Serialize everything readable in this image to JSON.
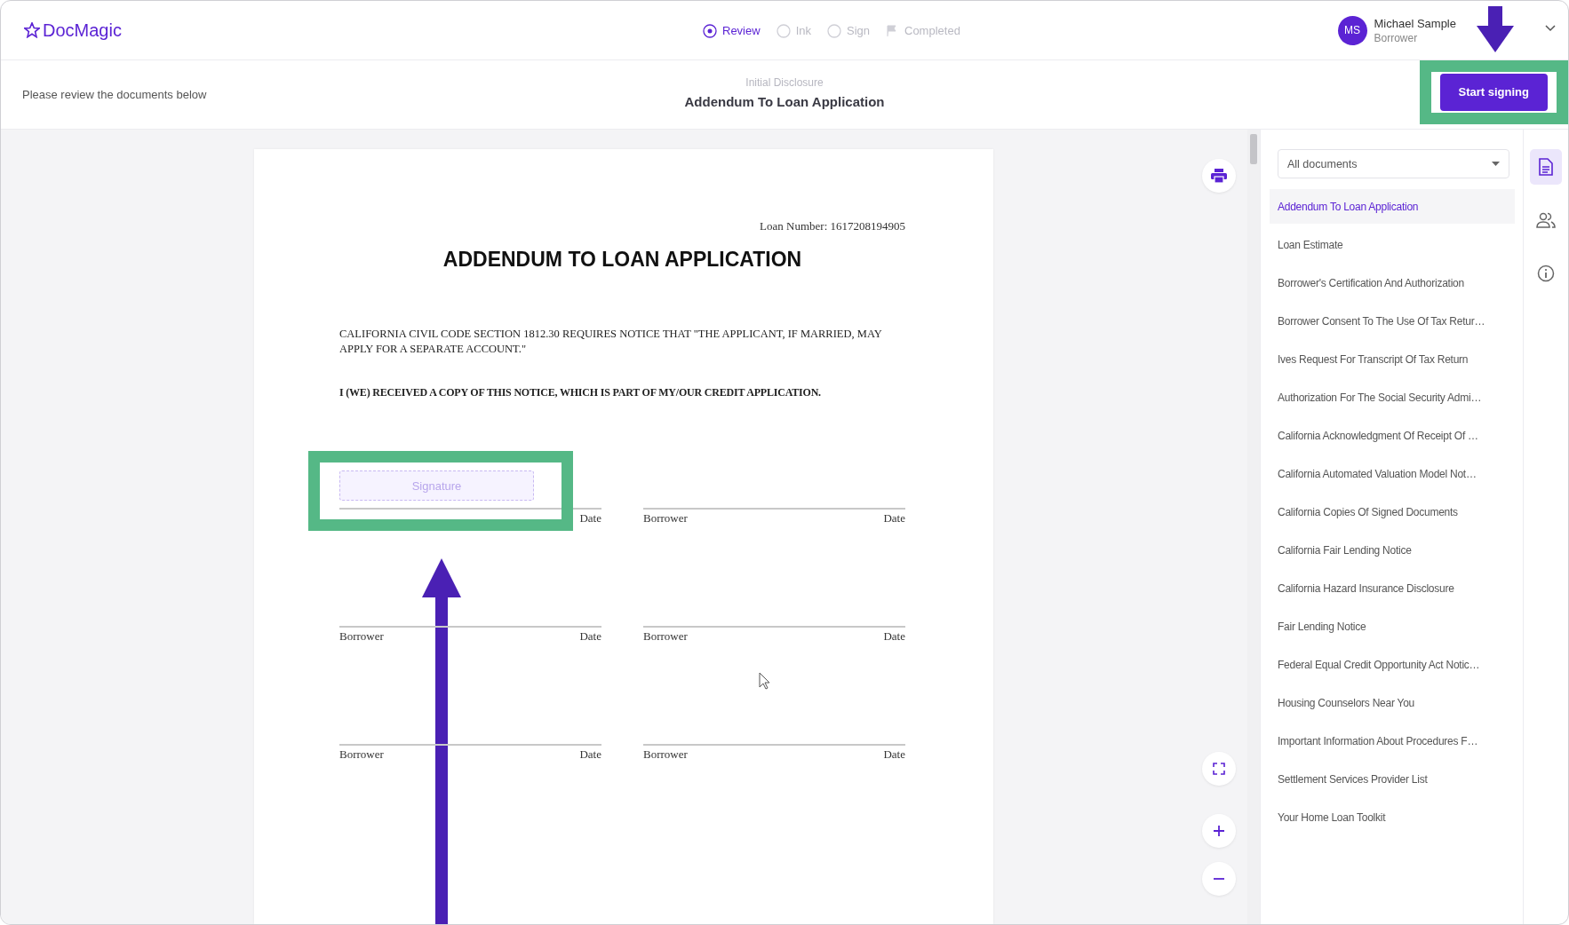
{
  "header": {
    "logo": "DocMagic",
    "steps": [
      {
        "label": "Review",
        "kind": "radio",
        "selected": true
      },
      {
        "label": "Ink",
        "kind": "radio",
        "selected": false
      },
      {
        "label": "Sign",
        "kind": "radio",
        "selected": false
      },
      {
        "label": "Completed",
        "kind": "flag",
        "selected": false
      }
    ],
    "user": {
      "initials": "MS",
      "name": "Michael Sample",
      "role": "Borrower"
    }
  },
  "subheader": {
    "instruction": "Please review the documents below",
    "category": "Initial Disclosure",
    "title": "Addendum To Loan Application",
    "start_button": {
      "label": "Start signing",
      "highlighted": true,
      "pointer_arrow": true
    }
  },
  "document": {
    "loan_number": "Loan Number: 1617208194905",
    "title": "ADDENDUM TO LOAN APPLICATION",
    "notice": "CALIFORNIA CIVIL CODE SECTION 1812.30 REQUIRES NOTICE THAT \"THE APPLICANT, IF MARRIED, MAY APPLY FOR A SEPARATE ACCOUNT.\"",
    "acknowledgement": "I (WE) RECEIVED A COPY OF THIS NOTICE, WHICH IS PART OF MY/OUR CREDIT APPLICATION.",
    "signature_blocks": [
      {
        "date": "Date",
        "signature_field": {
          "label": "Signature",
          "highlighted": true,
          "pointer_arrow": true
        }
      },
      {
        "signer": "Borrower",
        "date": "Date"
      },
      {
        "signer": "Borrower",
        "date": "Date"
      },
      {
        "signer": "Borrower",
        "date": "Date"
      },
      {
        "signer": "Borrower",
        "date": "Date"
      },
      {
        "signer": "Borrower",
        "date": "Date"
      }
    ]
  },
  "sidebar": {
    "filter": "All documents",
    "documents": [
      {
        "label": "Addendum To Loan Application",
        "selected": true
      },
      {
        "label": "Loan Estimate",
        "selected": false
      },
      {
        "label": "Borrower's Certification And Authorization",
        "selected": false
      },
      {
        "label": "Borrower Consent To The Use Of Tax Retur…",
        "selected": false
      },
      {
        "label": "Ives Request For Transcript Of Tax Return",
        "selected": false
      },
      {
        "label": "Authorization For The Social Security Admi…",
        "selected": false
      },
      {
        "label": "California Acknowledgment Of Receipt Of …",
        "selected": false
      },
      {
        "label": "California Automated Valuation Model Not…",
        "selected": false
      },
      {
        "label": "California Copies Of Signed Documents",
        "selected": false
      },
      {
        "label": "California Fair Lending Notice",
        "selected": false
      },
      {
        "label": "California Hazard Insurance Disclosure",
        "selected": false
      },
      {
        "label": "Fair Lending Notice",
        "selected": false
      },
      {
        "label": "Federal Equal Credit Opportunity Act Notic…",
        "selected": false
      },
      {
        "label": "Housing Counselors Near You",
        "selected": false
      },
      {
        "label": "Important Information About Procedures F…",
        "selected": false
      },
      {
        "label": "Settlement Services Provider List",
        "selected": false
      },
      {
        "label": "Your Home Loan Toolkit",
        "selected": false
      }
    ],
    "side_tabs": [
      {
        "kind": "document",
        "selected": true
      },
      {
        "kind": "people",
        "selected": false
      },
      {
        "kind": "info",
        "selected": false
      }
    ]
  }
}
